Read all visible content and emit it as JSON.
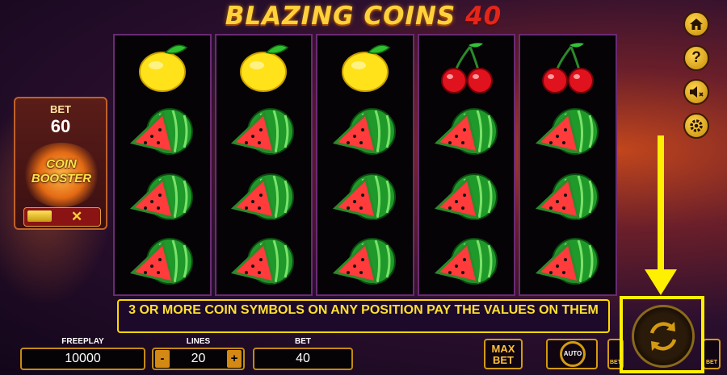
{
  "game": {
    "title_main": "BLAZING COINS",
    "title_num": "40"
  },
  "reels": [
    [
      "lemon",
      "watermelon",
      "watermelon",
      "watermelon"
    ],
    [
      "lemon",
      "watermelon",
      "watermelon",
      "watermelon"
    ],
    [
      "lemon",
      "watermelon",
      "watermelon",
      "watermelon"
    ],
    [
      "cherry",
      "watermelon",
      "watermelon",
      "watermelon"
    ],
    [
      "cherry",
      "watermelon",
      "watermelon",
      "watermelon"
    ]
  ],
  "bet_panel": {
    "label": "BET",
    "value": "60",
    "booster_line1": "COIN",
    "booster_line2": "BOOSTER",
    "toggle_off": "✕"
  },
  "side_buttons": {
    "home": "home-icon",
    "help": "?",
    "sound": "sound-off-icon",
    "settings": "gear-icon"
  },
  "info_text": "3 OR MORE COIN SYMBOLS ON ANY POSITION PAY THE VALUES ON THEM",
  "bottom": {
    "freeplay_label": "FREEPLAY",
    "freeplay_value": "10000",
    "lines_label": "LINES",
    "lines_value": "20",
    "minus": "-",
    "plus": "+",
    "bet_label": "BET",
    "bet_value": "40",
    "max_bet_line1": "MAX",
    "max_bet_line2": "BET",
    "auto_label": "AUTO",
    "bet_minus_label": "BET",
    "bet_plus_label": "BET"
  },
  "colors": {
    "accent_gold": "#d39a12",
    "highlight_yellow": "#ffef00",
    "reel_border": "#6b2a74"
  }
}
